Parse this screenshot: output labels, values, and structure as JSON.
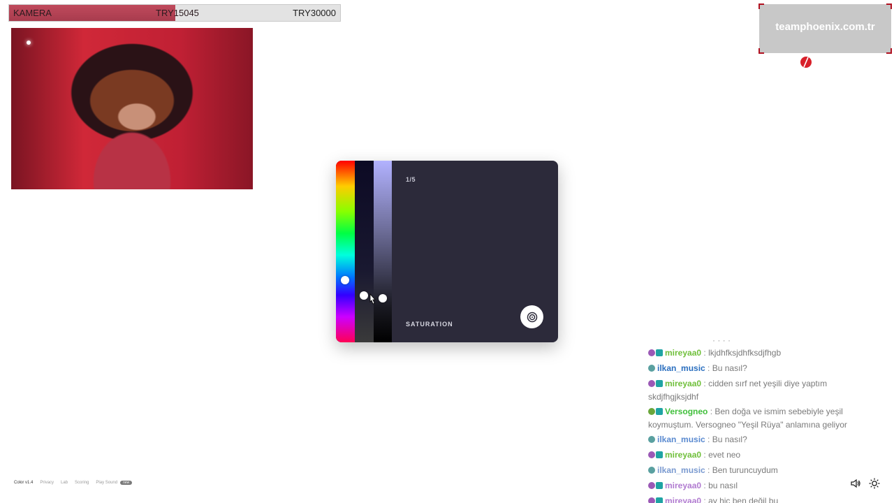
{
  "goal": {
    "label": "KAMERA",
    "current": "TRY15045",
    "target": "TRY30000",
    "progress": 0.5015,
    "fill_color": "#b84456"
  },
  "logo": {
    "text": "teamphoenix.com.tr",
    "accent": "#b01020"
  },
  "picker": {
    "step": "1/5",
    "mode": "SATURATION",
    "background": "#2c2a3a"
  },
  "chat": {
    "messages": [
      {
        "user": "mireyaa0",
        "sep": " : ",
        "text": "lkjdhfksjdhfksdjfhgb",
        "color": "#6fbf3a",
        "badges": [
          "purple",
          "teal"
        ]
      },
      {
        "user": "ilkan_music",
        "sep": " : ",
        "text": "Bu nasıl?",
        "color": "#2b6fbf",
        "badges": [
          "grey"
        ]
      },
      {
        "user": "mireyaa0",
        "sep": " : ",
        "text": "cidden sırf net yeşili diye yaptım skdjfhgjksjdhf",
        "color": "#6fbf3a",
        "badges": [
          "purple",
          "teal"
        ]
      },
      {
        "user": "Versogneo",
        "sep": " : ",
        "text": "Ben doğa ve ismim sebebiyle yeşil koymuştum. Versogneo \"Yeşil Rüya\" anlamına geliyor",
        "color": "#3fbf3a",
        "badges": [
          "green",
          "teal"
        ]
      },
      {
        "user": "ilkan_music",
        "sep": " : ",
        "text": "Bu nasıl?",
        "color": "#5a8ad0",
        "badges": [
          "grey"
        ]
      },
      {
        "user": "mireyaa0",
        "sep": " : ",
        "text": "evet neo",
        "color": "#6fbf3a",
        "badges": [
          "purple",
          "teal"
        ]
      },
      {
        "user": "ilkan_music",
        "sep": " : ",
        "text": "Ben turuncuydum",
        "color": "#7a9ad0",
        "badges": [
          "grey"
        ]
      },
      {
        "user": "mireyaa0",
        "sep": " : ",
        "text": "bu nasıl",
        "color": "#b07ad0",
        "badges": [
          "purple",
          "teal"
        ]
      },
      {
        "user": "mireyaa0",
        "sep": " : ",
        "text": "ay hiç ben değil bu",
        "color": "#b07ad0",
        "badges": [
          "purple",
          "teal"
        ]
      }
    ]
  },
  "footer": {
    "version": "Color v1.4",
    "privacy": "Privacy",
    "lab": "Lab",
    "scoring": "Scoring",
    "play_sound": "Play Sound",
    "pill": "new"
  },
  "icons": {
    "sound": "speaker-icon",
    "theme": "sun-icon",
    "submit": "target-icon"
  }
}
